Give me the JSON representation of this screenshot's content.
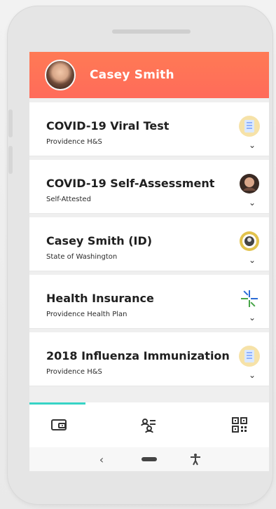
{
  "header": {
    "user_name": "Casey Smith"
  },
  "cards": [
    {
      "title": "COVID-19 Viral Test",
      "subtitle": "Providence H&S",
      "icon": "hospital-logo-icon"
    },
    {
      "title": "COVID-19 Self-Assessment",
      "subtitle": "Self-Attested",
      "icon": "avatar-icon"
    },
    {
      "title": "Casey Smith (ID)",
      "subtitle": "State of Washington",
      "icon": "state-seal-icon"
    },
    {
      "title": "Health Insurance",
      "subtitle": "Providence Health Plan",
      "icon": "insurance-logo-icon"
    },
    {
      "title": "2018 Influenza Immunization",
      "subtitle": "Providence H&S",
      "icon": "hospital-logo-icon"
    }
  ],
  "tabbar": {
    "tabs": [
      "wallet-icon",
      "people-list-icon",
      "qr-code-icon"
    ],
    "active_index": 0
  },
  "navbar": {
    "back": "‹",
    "accessibility": "🕴"
  },
  "colors": {
    "header_accent": "#ff6b5a",
    "tab_indicator": "#37d4c6"
  }
}
